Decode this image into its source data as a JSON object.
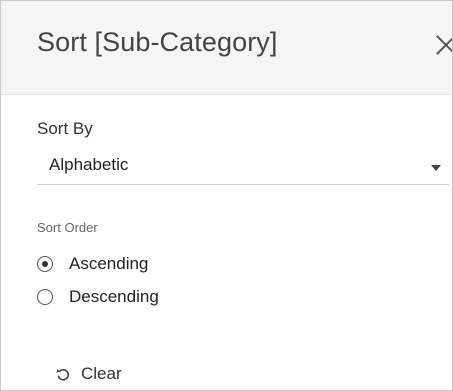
{
  "dialog": {
    "title": "Sort [Sub-Category]",
    "close_icon": "close-icon"
  },
  "sort_by": {
    "label": "Sort By",
    "selected": "Alphabetic"
  },
  "sort_order": {
    "label": "Sort Order",
    "options": [
      {
        "label": "Ascending",
        "checked": true
      },
      {
        "label": "Descending",
        "checked": false
      }
    ]
  },
  "actions": {
    "clear_label": "Clear",
    "clear_icon": "undo-icon"
  },
  "colors": {
    "header_bg": "#f5f5f5",
    "text": "#333333",
    "muted_text": "#666666"
  }
}
